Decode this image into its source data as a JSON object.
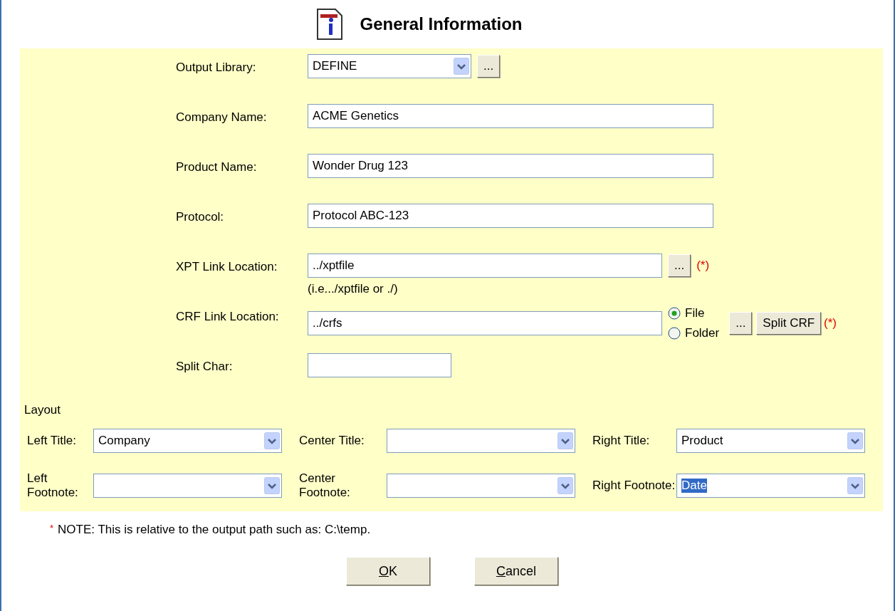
{
  "header": {
    "title": "General Information"
  },
  "fields": [
    {
      "kind": "select",
      "label": "Output Library:",
      "value": "DEFINE",
      "browse": "..."
    },
    {
      "kind": "text",
      "label": "Company Name:",
      "value": "ACME Genetics"
    },
    {
      "kind": "text",
      "label": "Product Name:",
      "value": "Wonder Drug 123"
    },
    {
      "kind": "text",
      "label": "Protocol:",
      "value": "Protocol ABC-123"
    },
    {
      "kind": "path",
      "label": "XPT Link Location:",
      "value": "../xptfile",
      "browse": "...",
      "required": "(*)",
      "note": "(i.e.../xptfile or ./)"
    },
    {
      "kind": "crf",
      "label": "CRF Link Location:",
      "value": "../crfs",
      "options": [
        {
          "label": "File",
          "selected": true
        },
        {
          "label": "Folder",
          "selected": false
        }
      ],
      "browse": "...",
      "split": "Split CRF",
      "required": "(*)"
    },
    {
      "kind": "short",
      "label": "Split Char:"
    }
  ],
  "layout": {
    "title": "Layout",
    "rows": [
      [
        {
          "label": "Left Title:",
          "value": "Company",
          "text_selected": false
        },
        {
          "label": "Center Title:"
        },
        {
          "label": "Right Title:",
          "value": "Product",
          "text_selected": false
        }
      ],
      [
        {
          "label": "Left Footnote:"
        },
        {
          "label": "Center Footnote:"
        },
        {
          "label": "Right Footnote:",
          "value": "Date",
          "text_selected": true
        }
      ]
    ]
  },
  "note": {
    "mark": "*",
    "text": "NOTE: This is relative to the output path such as: C:\\temp."
  },
  "buttons": [
    {
      "mnemonic": "O",
      "rest": "K"
    },
    {
      "mnemonic": "C",
      "rest": "ancel"
    }
  ]
}
